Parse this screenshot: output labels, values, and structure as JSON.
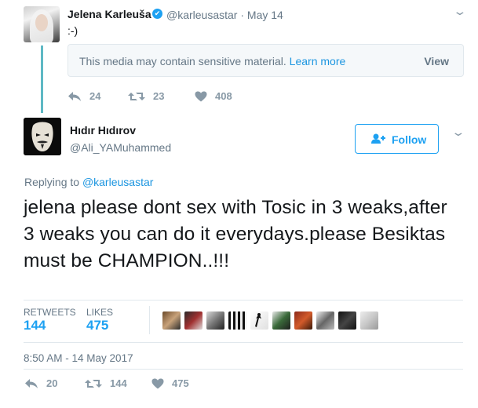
{
  "tweet1": {
    "author_name": "Jelena Karleuša",
    "handle": "@karleusastar",
    "date": "· May 14",
    "text": ":-)",
    "media_notice": "This media may contain sensitive material.",
    "learn_more": "Learn more",
    "view_label": "View",
    "replies": "24",
    "retweets": "23",
    "likes": "408"
  },
  "tweet2": {
    "author_name": "Hıdır Hıdırov",
    "handle": "@Ali_YAMuhammed",
    "follow_label": "Follow",
    "replying_prefix": "Replying to",
    "replying_handle": "@karleusastar",
    "text": "jelena please dont sex with Tosic in 3 weaks,after 3 weaks you can do it everydays.please Besiktas must be CHAMPION..!!!",
    "retweets_label": "RETWEETS",
    "retweets_count": "144",
    "likes_label": "LIKES",
    "likes_count": "475",
    "timestamp": "8:50 AM - 14 May 2017",
    "action_replies": "20",
    "action_retweets": "144",
    "action_likes": "475"
  },
  "colors": {
    "accent": "#1da1f2",
    "link": "#1b95e0",
    "muted": "#657786",
    "thread_line": "#5eb8c4"
  },
  "icons": [
    "reply-icon",
    "retweet-icon",
    "heart-icon",
    "verified-icon",
    "caret-down-icon",
    "follow-user-icon"
  ]
}
